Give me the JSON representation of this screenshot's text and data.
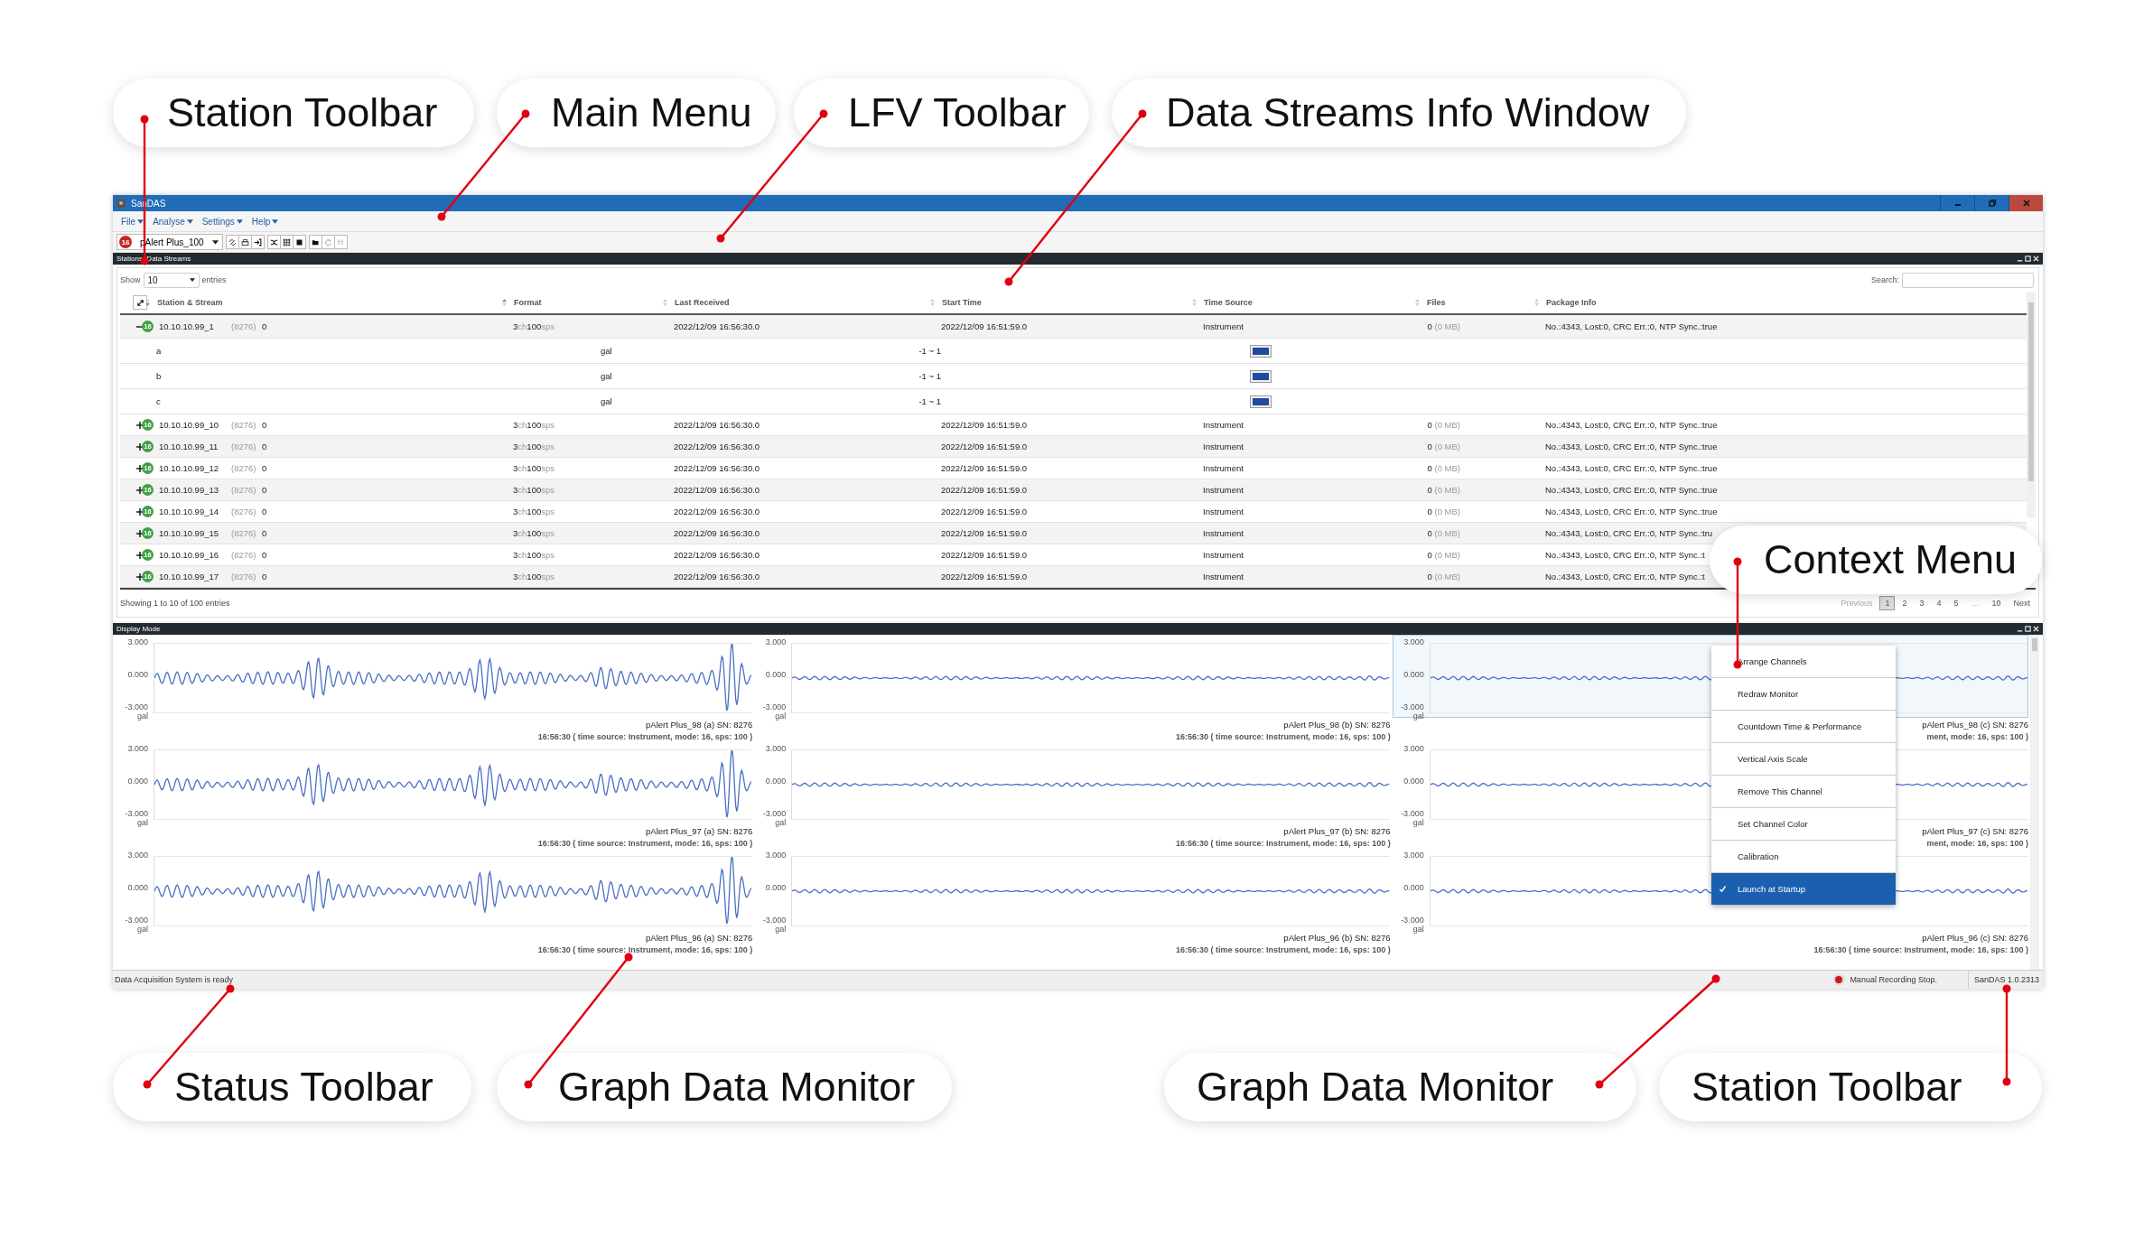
{
  "callouts": [
    {
      "label": "Station Toolbar"
    },
    {
      "label": "Main Menu"
    },
    {
      "label": "LFV Toolbar"
    },
    {
      "label": "Data Streams Info Window"
    },
    {
      "label": "Context Menu"
    },
    {
      "label": "Status Toolbar"
    },
    {
      "label": "Graph Data Monitor"
    },
    {
      "label": "Graph Data Monitor"
    },
    {
      "label": "Station Toolbar"
    }
  ],
  "window": {
    "title": "SanDAS"
  },
  "menu": [
    "File",
    "Analyse",
    "Settings",
    "Help"
  ],
  "toolbar": {
    "station_badge": "16",
    "station": "pAlert Plus_100",
    "text_button": {
      "label": "H",
      "disabled": true
    }
  },
  "streams_panel": {
    "title": "Stations: Data Streams",
    "show_label": "Show",
    "page_size": "10",
    "entries_label": "entries",
    "search_label": "Search:",
    "columns": [
      "Station & Stream",
      "Format",
      "Last Received",
      "Start Time",
      "Time Source",
      "Files",
      "Package Info"
    ],
    "rows": [
      {
        "station": "10.10.10.99_1",
        "badge": "16",
        "port": "(8276)",
        "count": "0",
        "expanded": true,
        "format": [
          "3",
          "ch",
          "100",
          "sps"
        ],
        "last_received": "2022/12/09 16:56:30.0",
        "start_time": "2022/12/09 16:51:59.0",
        "time_source": "Instrument",
        "files": "0",
        "files_size": "(0 MB)",
        "package": "No.:4343, Lost:0, CRC Err.:0, NTP Sync.:true",
        "children": [
          {
            "name": "a",
            "unit": "gal",
            "range": "-1 ~ 1"
          },
          {
            "name": "b",
            "unit": "gal",
            "range": "-1 ~ 1"
          },
          {
            "name": "c",
            "unit": "gal",
            "range": "-1 ~ 1"
          }
        ]
      },
      {
        "station": "10.10.10.99_10",
        "badge": "16",
        "port": "(8276)",
        "count": "0",
        "expanded": false,
        "format": [
          "3",
          "ch",
          "100",
          "sps"
        ],
        "last_received": "2022/12/09 16:56:30.0",
        "start_time": "2022/12/09 16:51:59.0",
        "time_source": "Instrument",
        "files": "0",
        "files_size": "(0 MB)",
        "package": "No.:4343, Lost:0, CRC Err.:0, NTP Sync.:true"
      },
      {
        "station": "10.10.10.99_11",
        "badge": "16",
        "port": "(8276)",
        "count": "0",
        "expanded": false,
        "format": [
          "3",
          "ch",
          "100",
          "sps"
        ],
        "last_received": "2022/12/09 16:56:30.0",
        "start_time": "2022/12/09 16:51:59.0",
        "time_source": "Instrument",
        "files": "0",
        "files_size": "(0 MB)",
        "package": "No.:4343, Lost:0, CRC Err.:0, NTP Sync.:true"
      },
      {
        "station": "10.10.10.99_12",
        "badge": "16",
        "port": "(8276)",
        "count": "0",
        "expanded": false,
        "format": [
          "3",
          "ch",
          "100",
          "sps"
        ],
        "last_received": "2022/12/09 16:56:30.0",
        "start_time": "2022/12/09 16:51:59.0",
        "time_source": "Instrument",
        "files": "0",
        "files_size": "(0 MB)",
        "package": "No.:4343, Lost:0, CRC Err.:0, NTP Sync.:true"
      },
      {
        "station": "10.10.10.99_13",
        "badge": "16",
        "port": "(8276)",
        "count": "0",
        "expanded": false,
        "format": [
          "3",
          "ch",
          "100",
          "sps"
        ],
        "last_received": "2022/12/09 16:56:30.0",
        "start_time": "2022/12/09 16:51:59.0",
        "time_source": "Instrument",
        "files": "0",
        "files_size": "(0 MB)",
        "package": "No.:4343, Lost:0, CRC Err.:0, NTP Sync.:true"
      },
      {
        "station": "10.10.10.99_14",
        "badge": "16",
        "port": "(8276)",
        "count": "0",
        "expanded": false,
        "format": [
          "3",
          "ch",
          "100",
          "sps"
        ],
        "last_received": "2022/12/09 16:56:30.0",
        "start_time": "2022/12/09 16:51:59.0",
        "time_source": "Instrument",
        "files": "0",
        "files_size": "(0 MB)",
        "package": "No.:4343, Lost:0, CRC Err.:0, NTP Sync.:true"
      },
      {
        "station": "10.10.10.99_15",
        "badge": "16",
        "port": "(8276)",
        "count": "0",
        "expanded": false,
        "format": [
          "3",
          "ch",
          "100",
          "sps"
        ],
        "last_received": "2022/12/09 16:56:30.0",
        "start_time": "2022/12/09 16:51:59.0",
        "time_source": "Instrument",
        "files": "0",
        "files_size": "(0 MB)",
        "package": "No.:4343, Lost:0, CRC Err.:0, NTP Sync.:tru"
      },
      {
        "station": "10.10.10.99_16",
        "badge": "16",
        "port": "(8276)",
        "count": "0",
        "expanded": false,
        "format": [
          "3",
          "ch",
          "100",
          "sps"
        ],
        "last_received": "2022/12/09 16:56:30.0",
        "start_time": "2022/12/09 16:51:59.0",
        "time_source": "Instrument",
        "files": "0",
        "files_size": "(0 MB)",
        "package": "No.:4343, Lost:0, CRC Err.:0, NTP Sync.:t"
      },
      {
        "station": "10.10.10.99_17",
        "badge": "16",
        "port": "(8276)",
        "count": "0",
        "expanded": false,
        "format": [
          "3",
          "ch",
          "100",
          "sps"
        ],
        "last_received": "2022/12/09 16:56:30.0",
        "start_time": "2022/12/09 16:51:59.0",
        "time_source": "Instrument",
        "files": "0",
        "files_size": "(0 MB)",
        "package": "No.:4343, Lost:0, CRC Err.:0, NTP Sync.:t"
      }
    ],
    "footer": "Showing 1 to 10 of 100 entries",
    "pagination": [
      {
        "label": "Previous",
        "selected": false,
        "disabled": true
      },
      {
        "label": "1",
        "selected": true,
        "disabled": false
      },
      {
        "label": "2",
        "selected": false,
        "disabled": false
      },
      {
        "label": "3",
        "selected": false,
        "disabled": false
      },
      {
        "label": "4",
        "selected": false,
        "disabled": false
      },
      {
        "label": "5",
        "selected": false,
        "disabled": false
      },
      {
        "label": "…",
        "selected": false,
        "disabled": true
      },
      {
        "label": "10",
        "selected": false,
        "disabled": false
      },
      {
        "label": "Next",
        "selected": false,
        "disabled": false
      }
    ]
  },
  "monitor": {
    "title": "Display Mode",
    "graphs": [
      {
        "y_ticks": [
          "3.000",
          "0.000",
          "-3.000"
        ],
        "unit": "gal",
        "station": "pAlert Plus_98 (a) SN: 8276",
        "info": "16:56:30 ( time source: Instrument, mode: 16, sps: 100 )",
        "kind": "burst",
        "highlighted": false
      },
      {
        "y_ticks": [
          "3.000",
          "0.000",
          "-3.000"
        ],
        "unit": "gal",
        "station": "pAlert Plus_98 (b) SN: 8276",
        "info": "16:56:30 ( time source: Instrument, mode: 16, sps: 100 )",
        "kind": "quiet",
        "highlighted": false
      },
      {
        "y_ticks": [
          "3.000",
          "0.000",
          "-3.000"
        ],
        "unit": "gal",
        "station": "pAlert Plus_98 (c) SN: 8276",
        "info": "ment, mode: 16, sps: 100 )",
        "kind": "quiet",
        "highlighted": true
      },
      {
        "y_ticks": [
          "3.000",
          "0.000",
          "-3.000"
        ],
        "unit": "gal",
        "station": "pAlert Plus_97 (a) SN: 8276",
        "info": "16:56:30 ( time source: Instrument, mode: 16, sps: 100 )",
        "kind": "burst",
        "highlighted": false
      },
      {
        "y_ticks": [
          "3.000",
          "0.000",
          "-3.000"
        ],
        "unit": "gal",
        "station": "pAlert Plus_97 (b) SN: 8276",
        "info": "16:56:30 ( time source: Instrument, mode: 16, sps: 100 )",
        "kind": "quiet",
        "highlighted": false
      },
      {
        "y_ticks": [
          "3.000",
          "0.000",
          "-3.000"
        ],
        "unit": "gal",
        "station": "pAlert Plus_97 (c) SN: 8276",
        "info": "ment, mode: 16, sps: 100 )",
        "kind": "quiet",
        "highlighted": false
      },
      {
        "y_ticks": [
          "3.000",
          "0.000",
          "-3.000"
        ],
        "unit": "gal",
        "station": "pAlert Plus_96 (a) SN: 8276",
        "info": "16:56:30 ( time source: Instrument, mode: 16, sps: 100 )",
        "kind": "burst",
        "highlighted": false
      },
      {
        "y_ticks": [
          "3.000",
          "0.000",
          "-3.000"
        ],
        "unit": "gal",
        "station": "pAlert Plus_96 (b) SN: 8276",
        "info": "16:56:30 ( time source: Instrument, mode: 16, sps: 100 )",
        "kind": "quiet",
        "highlighted": false
      },
      {
        "y_ticks": [
          "3.000",
          "0.000",
          "-3.000"
        ],
        "unit": "gal",
        "station": "pAlert Plus_96 (c) SN: 8276",
        "info": "16:56:30 ( time source: Instrument, mode: 16, sps: 100 )",
        "kind": "quiet",
        "highlighted": false
      }
    ],
    "context_menu": [
      {
        "label": "Arrange Channels",
        "checked": false,
        "selected": false
      },
      {
        "label": "Redraw Monitor",
        "checked": false,
        "selected": false
      },
      {
        "label": "Countdown Time & Performance",
        "checked": false,
        "selected": false
      },
      {
        "label": "Vertical Axis Scale",
        "checked": false,
        "selected": false
      },
      {
        "label": "Remove This Channel",
        "checked": false,
        "selected": false
      },
      {
        "label": "Set Channel Color",
        "checked": false,
        "selected": false
      },
      {
        "label": "Calibration",
        "checked": false,
        "selected": false
      },
      {
        "label": "Launch at Startup",
        "checked": true,
        "selected": true
      }
    ]
  },
  "status_bar": {
    "message": "Data Acquisition System is ready",
    "recording": "Manual Recording Stop.",
    "version": "SanDAS 1.0.2313"
  }
}
